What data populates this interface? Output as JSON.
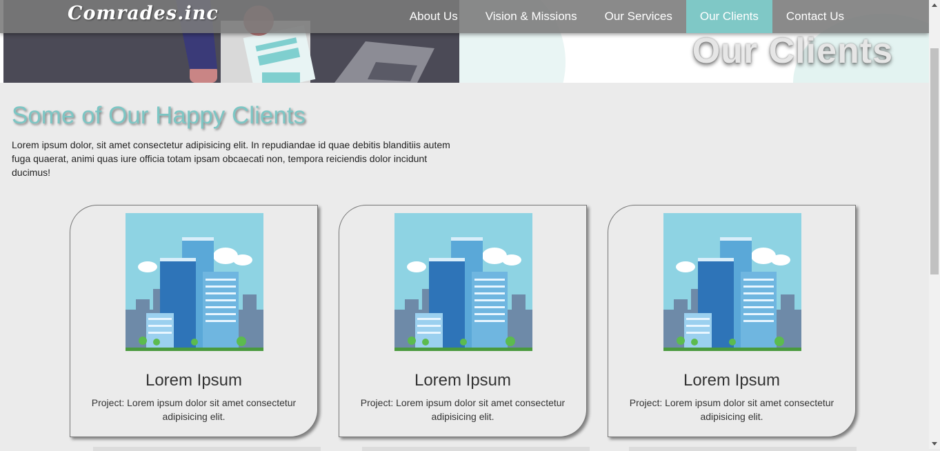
{
  "brand": {
    "logo": "Comrades.inc"
  },
  "nav": {
    "items": [
      {
        "label": "About Us"
      },
      {
        "label": "Vision & Missions"
      },
      {
        "label": "Our Services"
      },
      {
        "label": "Our Clients"
      },
      {
        "label": "Contact Us"
      }
    ],
    "active_index": 3
  },
  "hero": {
    "title": "Our Clients"
  },
  "section": {
    "heading": "Some of Our Happy Clients",
    "intro": "Lorem ipsum dolor, sit amet consectetur adipisicing elit. In repudiandae id quae debitis blanditiis autem fuga quaerat, animi quas iure officia totam ipsam obcaecati non, tempora reiciendis dolor incidunt ducimus!"
  },
  "cards": [
    {
      "title": "Lorem Ipsum",
      "description": "Project: Lorem ipsum dolor sit amet consectetur adipisicing elit."
    },
    {
      "title": "Lorem Ipsum",
      "description": "Project: Lorem ipsum dolor sit amet consectetur adipisicing elit."
    },
    {
      "title": "Lorem Ipsum",
      "description": "Project: Lorem ipsum dolor sit amet consectetur adipisicing elit."
    }
  ],
  "colors": {
    "accent": "#7fc8c6",
    "navbar": "#7a7a7a",
    "page_bg": "#ebebeb"
  }
}
